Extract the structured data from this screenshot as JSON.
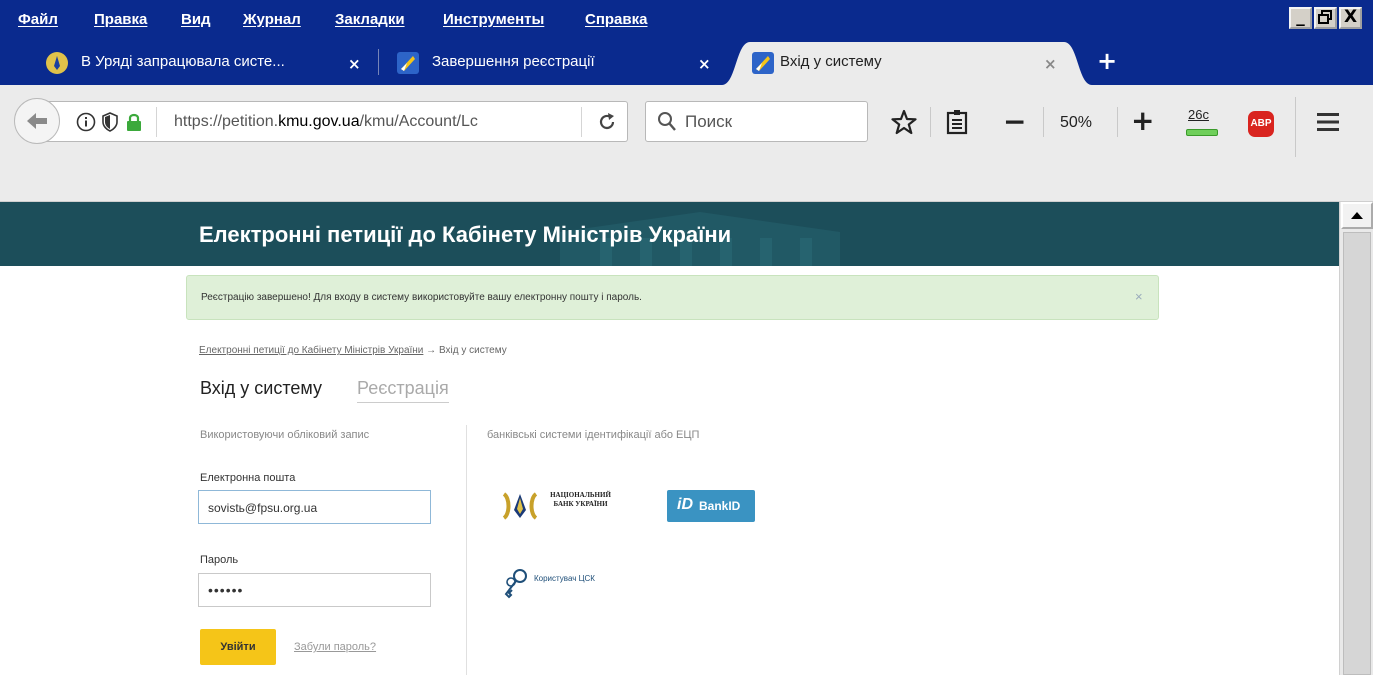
{
  "menu": {
    "items": [
      "Файл",
      "Правка",
      "Вид",
      "Журнал",
      "Закладки",
      "Инструменты",
      "Справка"
    ]
  },
  "window_controls": {
    "minimize": "_",
    "maximize": "□",
    "close": "X"
  },
  "tabs": [
    {
      "title": "В Уряді запрацювала систе...",
      "close": "×",
      "active": false
    },
    {
      "title": "Завершення реєстрації",
      "close": "×",
      "active": false
    },
    {
      "title": "Вхід у систему",
      "close": "×",
      "active": true
    }
  ],
  "new_tab_label": "+",
  "url": {
    "prefix": "https://petition.",
    "domain": "kmu.gov.ua",
    "path": "/kmu/Account/Lc"
  },
  "search": {
    "placeholder": "Поиск"
  },
  "zoom": {
    "minus": "−",
    "value": "50%",
    "plus": "+"
  },
  "counter_badge": "26c",
  "abp_label": "ABP",
  "colors": {
    "accent": "#0a2a8e",
    "banner": "#1c4e5a",
    "button_yellow": "#f5c518",
    "alert_bg": "#dff0d8",
    "bankid": "#3a93c2"
  },
  "site": {
    "title": "Електронні петиції до Кабінету Міністрів України",
    "alert": "Реєстрацію завершено! Для входу в систему використовуйте вашу електронну пошту і пароль.",
    "alert_close": "×",
    "breadcrumb": {
      "home": "Електронні петиції до Кабінету Міністрів України",
      "arrow": "→",
      "current": "Вхід у систему"
    },
    "tabs": {
      "login": "Вхід у систему",
      "register": "Реєстрація"
    },
    "left_heading": "Використовуючи обліковий запис",
    "right_heading": "банківські системи ідентифікації або ЕЦП",
    "email_label": "Електронна пошта",
    "email_value": "sovistь@fpsu.org.ua",
    "password_label": "Пароль",
    "password_value": "••••••",
    "login_button": "Увійти",
    "forgot_link": "Забули пароль?",
    "nbu_text": "НАЦІОНАЛЬНИЙ БАНК УКРАЇНИ",
    "bankid": {
      "mark": "iD",
      "label": "BankID"
    },
    "csk_text": "Користувач ЦСК"
  }
}
